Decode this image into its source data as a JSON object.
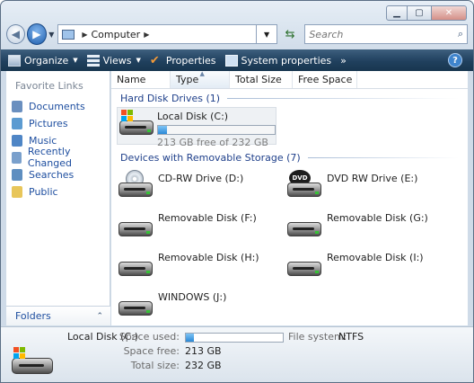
{
  "address": {
    "location": "Computer",
    "search_placeholder": "Search"
  },
  "toolbar": {
    "organize": "Organize",
    "views": "Views",
    "properties": "Properties",
    "system_properties": "System properties",
    "more": "»",
    "help": "?"
  },
  "nav": {
    "title": "Favorite Links",
    "items": [
      {
        "label": "Documents",
        "icon": "documents-icon",
        "color": "#6a8fbf"
      },
      {
        "label": "Pictures",
        "icon": "pictures-icon",
        "color": "#5c9bd1"
      },
      {
        "label": "Music",
        "icon": "music-icon",
        "color": "#4f86c6"
      },
      {
        "label": "Recently Changed",
        "icon": "recently-changed-icon",
        "color": "#7aa0cc"
      },
      {
        "label": "Searches",
        "icon": "searches-icon",
        "color": "#5e8ec0"
      },
      {
        "label": "Public",
        "icon": "public-folder-icon",
        "color": "#e8c65a"
      }
    ],
    "folders": "Folders"
  },
  "columns": [
    "Name",
    "Type",
    "Total Size",
    "Free Space"
  ],
  "groups": {
    "hard_disks": "Hard Disk Drives (1)",
    "removable": "Devices with Removable Storage (7)"
  },
  "local_disk": {
    "name": "Local Disk (C:)",
    "free_text": "213 GB free of 232 GB",
    "used_fraction": 0.08
  },
  "devices": [
    {
      "name": "CD-RW Drive (D:)",
      "kind": "cd"
    },
    {
      "name": "DVD RW Drive (E:)",
      "kind": "dvd",
      "badge": "DVD"
    },
    {
      "name": "Removable Disk (F:)",
      "kind": "removable"
    },
    {
      "name": "Removable Disk (G:)",
      "kind": "removable"
    },
    {
      "name": "Removable Disk (H:)",
      "kind": "removable"
    },
    {
      "name": "Removable Disk (I:)",
      "kind": "removable"
    },
    {
      "name": "WINDOWS (J:)",
      "kind": "removable"
    }
  ],
  "details": {
    "name": "Local Disk (C:)",
    "space_used_label": "Space used:",
    "used_fraction": 0.08,
    "file_system_label": "File system:",
    "file_system": "NTFS",
    "space_free_label": "Space free:",
    "space_free": "213 GB",
    "total_size_label": "Total size:",
    "total_size": "232 GB"
  }
}
